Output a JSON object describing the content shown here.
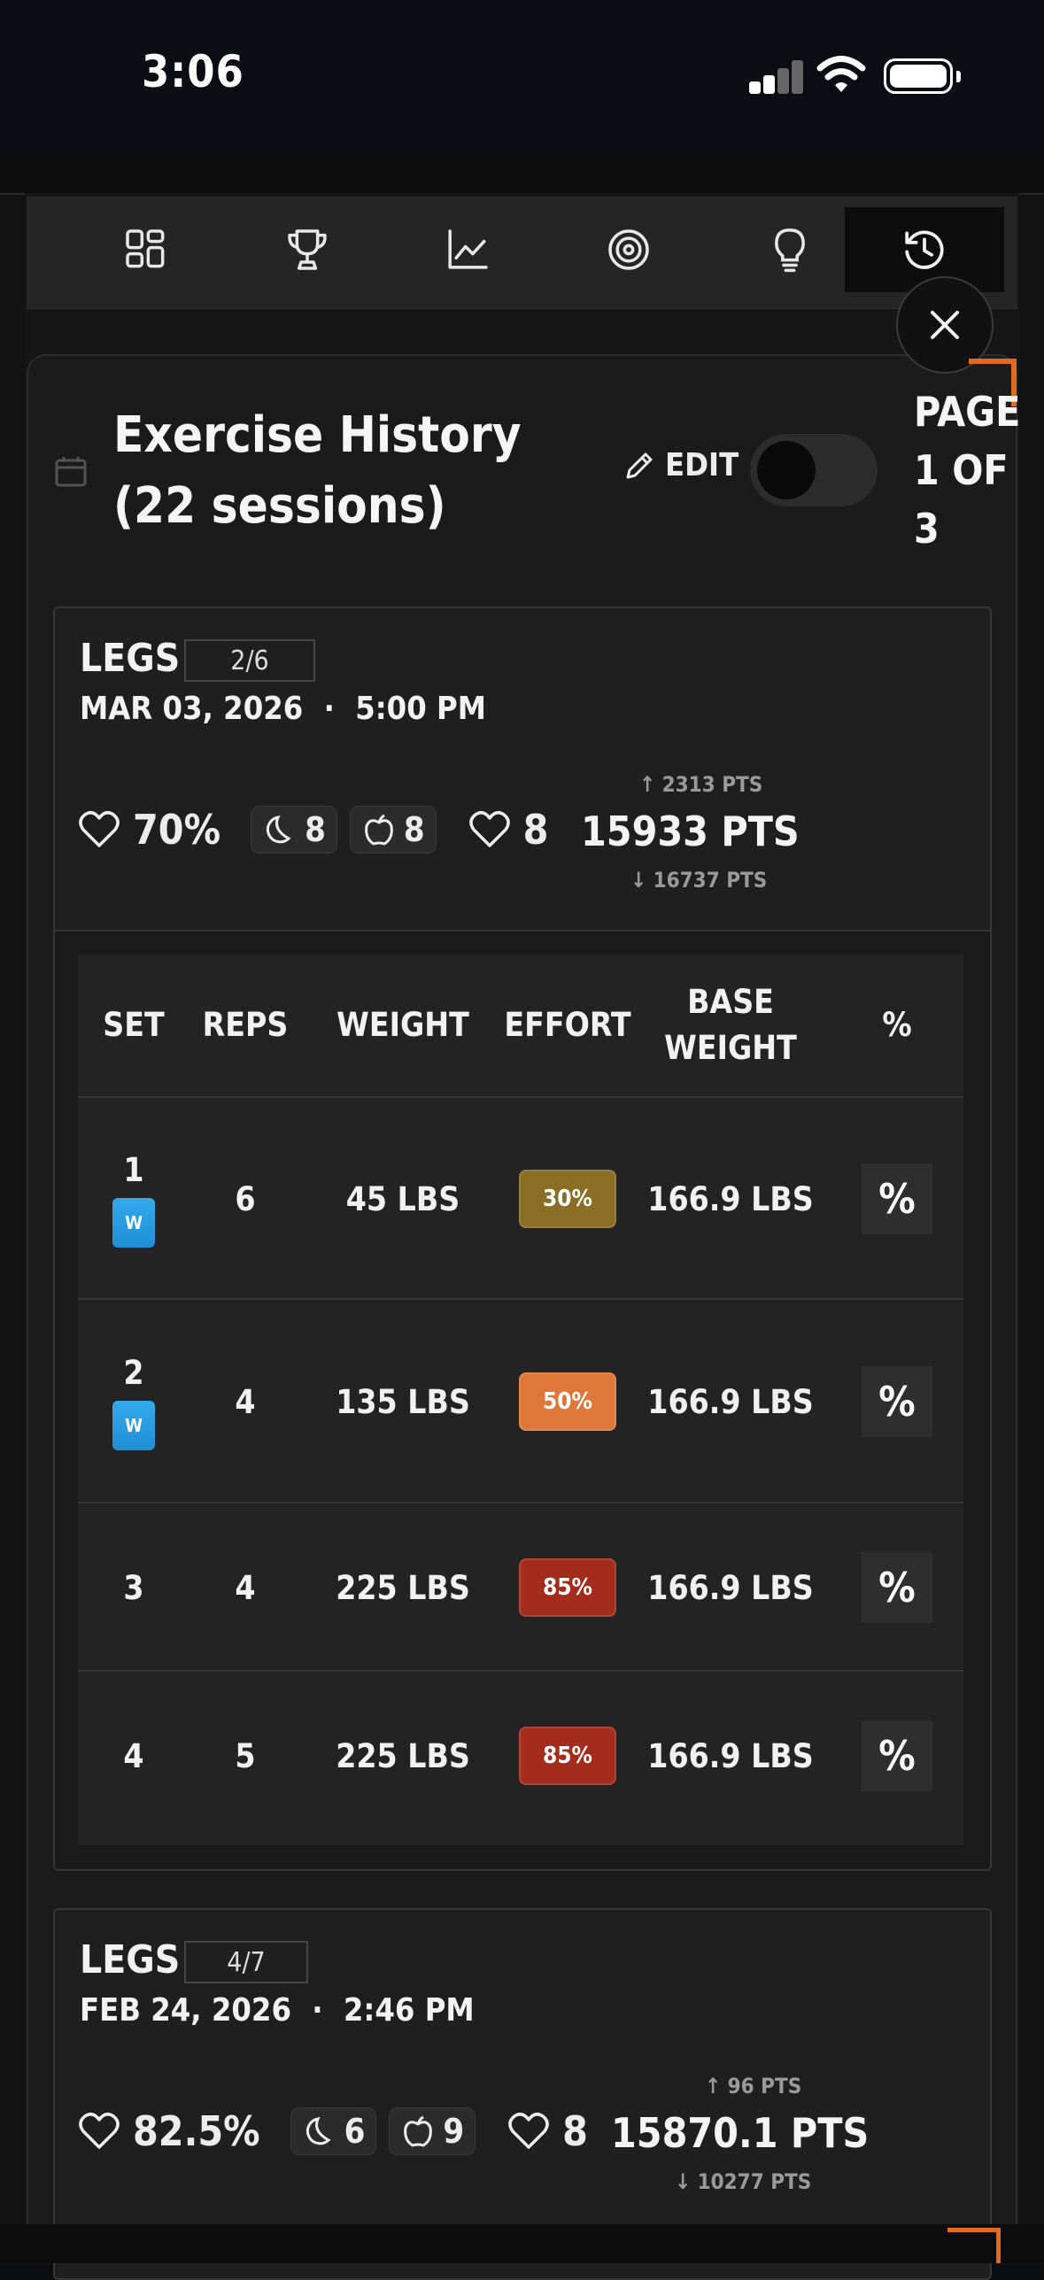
{
  "status_bar": {
    "time": "3:06"
  },
  "tabs": [
    {
      "icon": "dashboard-icon"
    },
    {
      "icon": "trophy-icon"
    },
    {
      "icon": "chart-icon"
    },
    {
      "icon": "target-icon"
    },
    {
      "icon": "lightbulb-icon"
    },
    {
      "icon": "history-icon",
      "active": true
    }
  ],
  "header": {
    "title_line1": "Exercise History",
    "title_line2": "(22 sessions)",
    "edit_label": "EDIT",
    "edit_toggle_on": false,
    "page_line1": "PAGE",
    "page_line2": "1 OF",
    "page_line3": "3"
  },
  "sessions": [
    {
      "name": "LEGS",
      "badge": "2/6",
      "date": "MAR 03, 2026",
      "time": "5:00 PM",
      "heart_pct": "70%",
      "sleep": "8",
      "nutrition": "8",
      "heart_score": "8",
      "pts": "15933 PTS",
      "pts_up": "2313 PTS",
      "pts_down": "16737 PTS",
      "table_headers": {
        "set": "SET",
        "reps": "REPS",
        "weight": "WEIGHT",
        "effort": "EFFORT",
        "base_weight_1": "BASE",
        "base_weight_2": "WEIGHT",
        "pct": "%"
      },
      "sets": [
        {
          "set": "1",
          "warmup": "W",
          "reps": "6",
          "weight": "45 LBS",
          "effort": "30%",
          "effort_color": "#8a6e26",
          "base_weight": "166.9 LBS",
          "pct": "%"
        },
        {
          "set": "2",
          "warmup": "W",
          "reps": "4",
          "weight": "135 LBS",
          "effort": "50%",
          "effort_color": "#e0773a",
          "base_weight": "166.9 LBS",
          "pct": "%"
        },
        {
          "set": "3",
          "reps": "4",
          "weight": "225 LBS",
          "effort": "85%",
          "effort_color": "#a42c1c",
          "base_weight": "166.9 LBS",
          "pct": "%"
        },
        {
          "set": "4",
          "reps": "5",
          "weight": "225 LBS",
          "effort": "85%",
          "effort_color": "#a42c1c",
          "base_weight": "166.9 LBS",
          "pct": "%"
        }
      ]
    },
    {
      "name": "LEGS",
      "badge": "4/7",
      "date": "FEB 24, 2026",
      "time": "2:46 PM",
      "heart_pct": "82.5%",
      "sleep": "6",
      "nutrition": "9",
      "heart_score": "8",
      "pts": "15870.1 PTS",
      "pts_up": "96 PTS",
      "pts_down": "10277 PTS"
    }
  ],
  "colors": {
    "accent": "#e26a1d",
    "warmup_badge": "#2a9be0",
    "background": "#1b1b1b"
  }
}
